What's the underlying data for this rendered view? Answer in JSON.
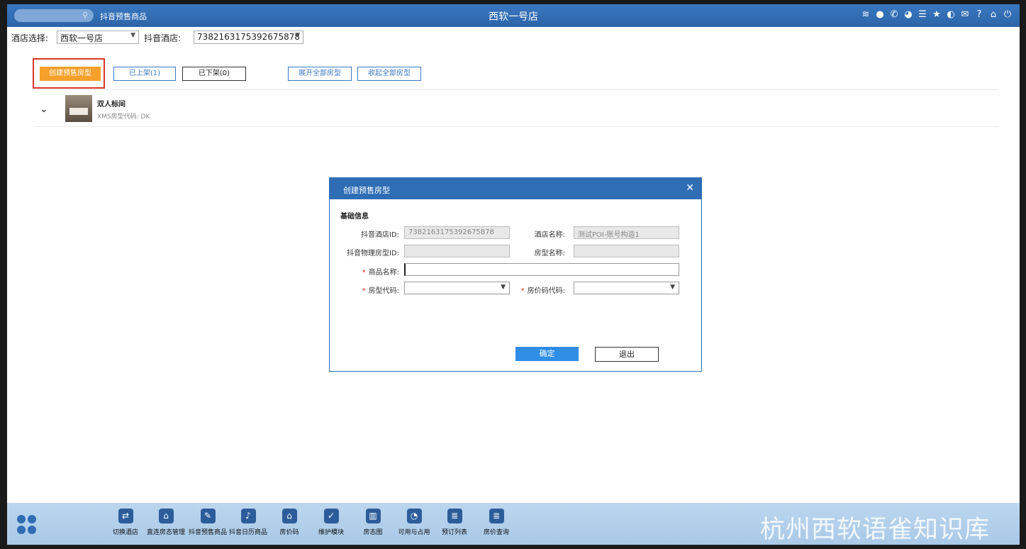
{
  "top": {
    "tab_title": "抖音预售商品",
    "hotel_title": "西软一号店",
    "icons": [
      "wifi-icon",
      "chat-icon",
      "phone-icon",
      "palette-icon",
      "menu-icon",
      "star-icon",
      "moon-icon",
      "mail-icon",
      "help-icon",
      "home-icon",
      "power-icon"
    ]
  },
  "selector": {
    "hotel_label": "酒店选择:",
    "hotel_value": "西软一号店",
    "douyin_label": "抖音酒店:",
    "douyin_value": "7382163175392675878"
  },
  "actions": {
    "create": "创建预售房型",
    "listed": "已上架(1)",
    "unlisted": "已下架(0)",
    "expand": "展开全部房型",
    "collapse": "收起全部房型"
  },
  "room": {
    "name": "双人标间",
    "code": "XMS房型代码: DK"
  },
  "dialog": {
    "title": "创建预售房型",
    "section": "基础信息",
    "douyin_hotel_id_label": "抖音酒店ID:",
    "douyin_hotel_id_value": "7382163175392675878",
    "hotel_name_label": "酒店名称:",
    "hotel_name_value": "测试POI-账号构造1",
    "physical_room_id_label": "抖音物理房型ID:",
    "room_name_label": "房型名称:",
    "product_name_label": "商品名称:",
    "room_code_label": "房型代码:",
    "rate_code_label": "房价码代码:",
    "ok": "确定",
    "exit": "退出"
  },
  "bottom": {
    "items": [
      {
        "label": "切换酒店",
        "icon": "switch-icon",
        "glyph": "⇄"
      },
      {
        "label": "直连房态管理",
        "icon": "house-gear-icon",
        "glyph": "⌂"
      },
      {
        "label": "抖音预售商品",
        "icon": "edit-doc-icon",
        "glyph": "✎"
      },
      {
        "label": "抖音日历商品",
        "icon": "tiktok-icon",
        "glyph": "♪"
      },
      {
        "label": "房价码",
        "icon": "home-icon",
        "glyph": "⌂"
      },
      {
        "label": "维护模块",
        "icon": "wrench-icon",
        "glyph": "✓"
      },
      {
        "label": "房态图",
        "icon": "bank-icon",
        "glyph": "▥"
      },
      {
        "label": "可用与占用",
        "icon": "pie-chart-icon",
        "glyph": "◔"
      },
      {
        "label": "预订列表",
        "icon": "list-doc-icon",
        "glyph": "≣"
      },
      {
        "label": "房价查询",
        "icon": "search-doc-icon",
        "glyph": "≣"
      }
    ],
    "watermark": "杭州西软语雀知识库"
  }
}
